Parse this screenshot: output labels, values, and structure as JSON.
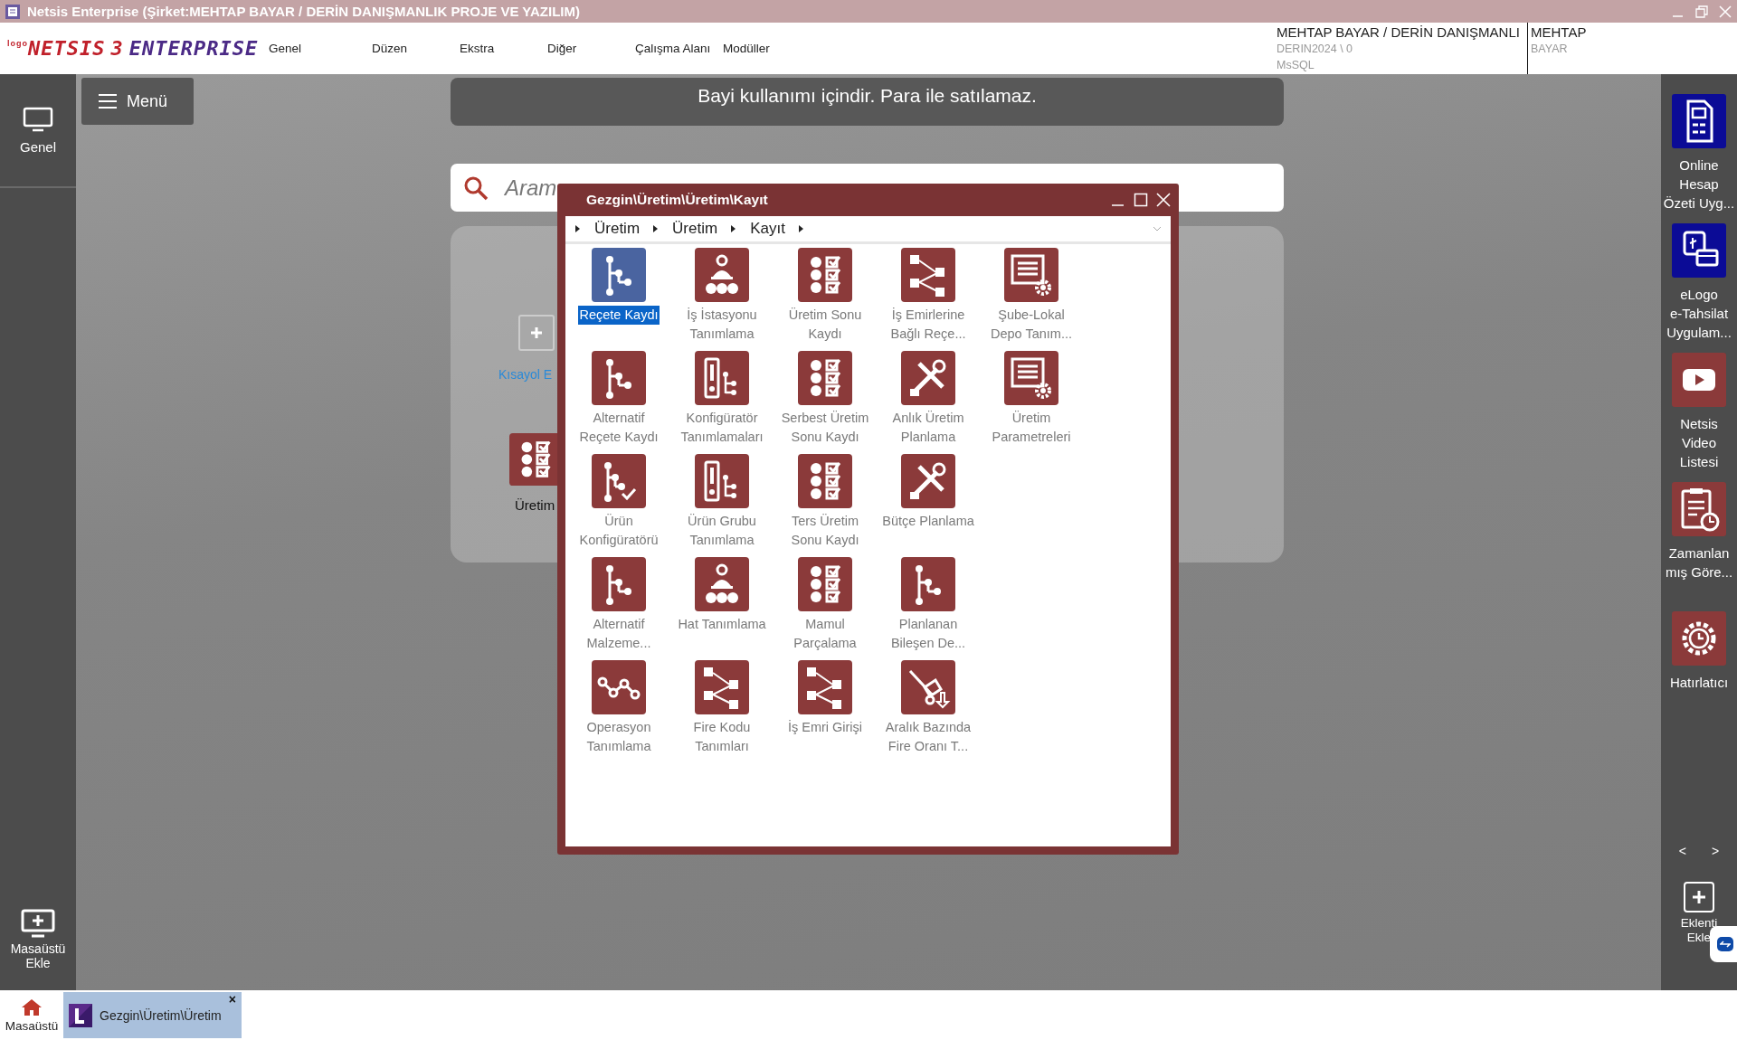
{
  "window": {
    "title": "Netsis Enterprise (Şirket:MEHTAP BAYAR / DERİN DANIŞMANLIK PROJE VE YAZILIM)"
  },
  "logo": {
    "small": "logo",
    "brand": "NETSIS",
    "version": "3",
    "edition": "ENTERPRISE"
  },
  "menu": [
    "Genel",
    "Düzen",
    "Ekstra",
    "Diğer",
    "Çalışma Alanı",
    "Modüller"
  ],
  "company": {
    "name": "MEHTAP BAYAR / DERİN DANIŞMANLI",
    "database": "DERIN2024 \\ 0",
    "server": "MsSQL",
    "user_first": "MEHTAP",
    "user_last": "BAYAR"
  },
  "left_sidebar": {
    "top": "Genel",
    "bottom": "Masaüstü Ekle"
  },
  "menu_button": "Menü",
  "notice": "Bayi kullanımı içindir. Para ile satılamaz.",
  "search": {
    "placeholder": "Aram"
  },
  "shortcut_panel": {
    "add_label": "Kısayol E",
    "tile_label": "Üretim"
  },
  "dialog": {
    "title": "Gezgin\\Üretim\\Üretim\\Kayıt",
    "breadcrumb": [
      "Üretim",
      "Üretim",
      "Kayıt"
    ],
    "rows": [
      [
        {
          "label": "Reçete Kaydı",
          "kind": "tree",
          "selected": true
        },
        {
          "label": "İş İstasyonu Tanımlama",
          "kind": "station",
          "selected": false
        },
        {
          "label": "Üretim Sonu Kaydı",
          "kind": "checklist",
          "selected": false
        },
        {
          "label": "İş Emirlerine Bağlı Reçe...",
          "kind": "flow",
          "selected": false
        },
        {
          "label": "Şube-Lokal Depo Tanım...",
          "kind": "docgear",
          "selected": false
        }
      ],
      [
        {
          "label": "Alternatif Reçete Kaydı",
          "kind": "tree",
          "selected": false
        },
        {
          "label": "Konfigüratör Tanımlamaları",
          "kind": "config",
          "selected": false
        },
        {
          "label": "Serbest Üretim Sonu Kaydı",
          "kind": "checklist",
          "selected": false
        },
        {
          "label": "Anlık Üretim Planlama",
          "kind": "tools",
          "selected": false
        },
        {
          "label": "Üretim Parametreleri",
          "kind": "docgear",
          "selected": false
        }
      ],
      [
        {
          "label": "Ürün Konfigüratörü",
          "kind": "treecheck",
          "selected": false
        },
        {
          "label": "Ürün Grubu Tanımlama",
          "kind": "config",
          "selected": false
        },
        {
          "label": "Ters Üretim Sonu Kaydı",
          "kind": "checklist",
          "selected": false
        },
        {
          "label": "Bütçe Planlama",
          "kind": "tools",
          "selected": false
        }
      ],
      [
        {
          "label": "Alternatif Malzeme...",
          "kind": "tree",
          "selected": false
        },
        {
          "label": "Hat Tanımlama",
          "kind": "station",
          "selected": false
        },
        {
          "label": "Mamul Parçalama",
          "kind": "checklist",
          "selected": false
        },
        {
          "label": "Planlanan Bileşen De...",
          "kind": "tree",
          "selected": false
        }
      ],
      [
        {
          "label": "Operasyon Tanımlama",
          "kind": "waypoints",
          "selected": false
        },
        {
          "label": "Fire Kodu Tanımları",
          "kind": "flow",
          "selected": false
        },
        {
          "label": "İş Emri Girişi",
          "kind": "flow",
          "selected": false
        },
        {
          "label": "Aralık Bazında Fire Oranı T...",
          "kind": "truck",
          "selected": false
        }
      ]
    ]
  },
  "right_sidebar": {
    "items": [
      {
        "lines": [
          "Online",
          "Hesap",
          "Özeti Uyg..."
        ],
        "kind": "statement",
        "color": "#0b0b96"
      },
      {
        "lines": [
          "eLogo",
          "e-Tahsilat",
          "Uygulam..."
        ],
        "kind": "payment",
        "color": "#0b0b96"
      },
      {
        "lines": [
          "Netsis",
          "Video",
          "Listesi"
        ],
        "kind": "video",
        "color": "#8b3a3a"
      },
      {
        "lines": [
          "Zamanlan",
          "mış Göre..."
        ],
        "kind": "schedule",
        "color": "#8b3a3a"
      },
      {
        "lines": [
          "Hatırlatıcı"
        ],
        "kind": "reminder",
        "color": "#8b3a3a"
      }
    ],
    "prev": "<",
    "next": ">",
    "add": "Eklenti Ekle"
  },
  "taskbar": {
    "home": "Masaüstü",
    "tabs": [
      {
        "label": "Gezgin\\Üretim\\Üretim",
        "close": "×",
        "selected": true
      }
    ]
  }
}
